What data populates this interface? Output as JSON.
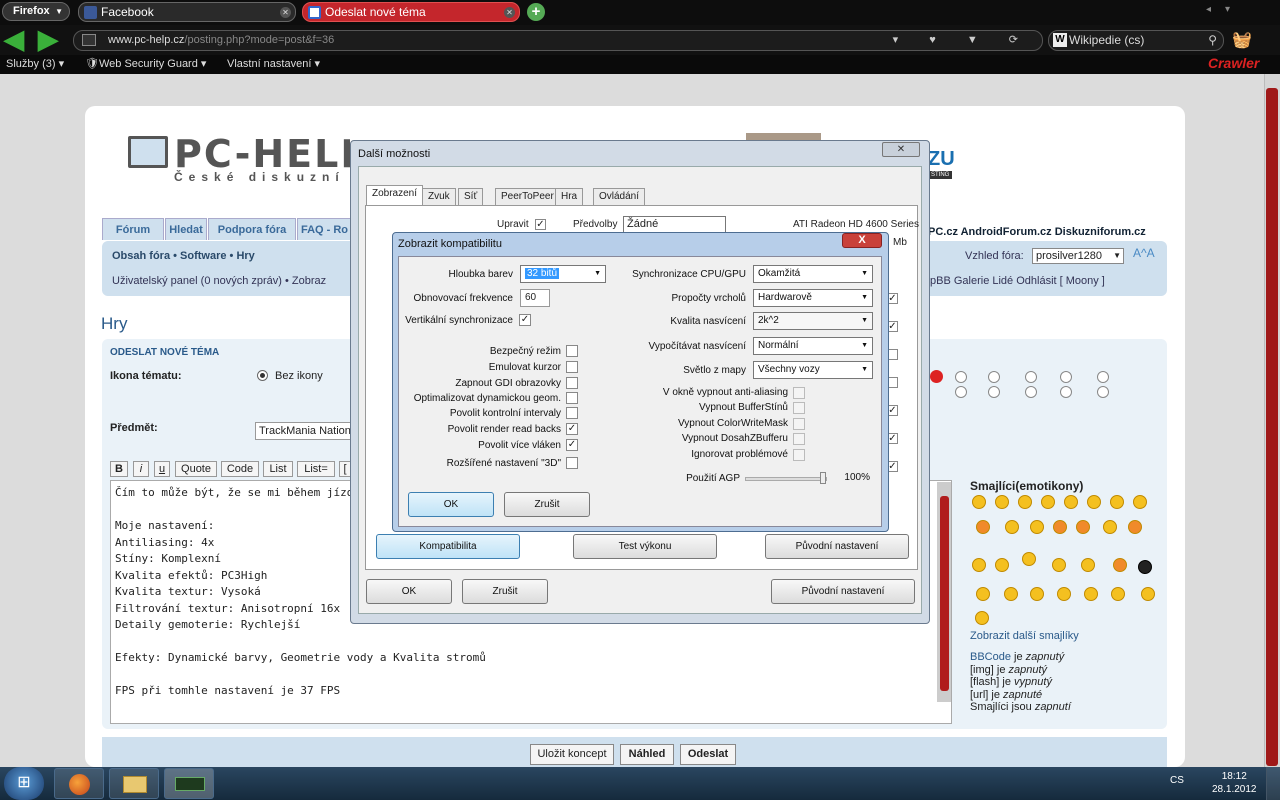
{
  "browser": {
    "menu_label": "Firefox",
    "tabs": [
      {
        "label": "Facebook",
        "color": "#3b5998"
      },
      {
        "label": "Odeslat nové téma",
        "color": "#c4262c"
      }
    ],
    "url_domain": "www.pc-help.cz",
    "url_path": "/posting.php?mode=post&f=36",
    "search_engine": "Wikipedie (cs)",
    "bookmarks": [
      "Služby (3) ▾",
      "Web Security Guard ▾",
      "Vlastní nastavení ▾"
    ],
    "toolbar_brand": "Crawler"
  },
  "site": {
    "logo_text": "PC-HELP",
    "logo_sub": "České diskuzní fórum",
    "logo_right": "ZU",
    "logo_host": "STING",
    "nav_tabs": [
      "Fórum",
      "Hledat",
      "Podpora fóra",
      "FAQ - Ro"
    ],
    "top_links": "PC.cz  AndroidForum.cz  Diskuzniforum.cz",
    "breadcrumb": "Obsah fóra • Software • Hry",
    "vzhled_label": "Vzhled fóra:",
    "vzhled_value": "prosilver1280",
    "user_panel": "Uživatelský panel (0 nových zpráv) • Zobraz",
    "right_links": "pBB  Galerie  Lidé  Odhlásit [ Moony ]",
    "page_heading": "Hry",
    "form_title": "ODESLAT NOVÉ TÉMA",
    "ikona_label": "Ikona tématu:",
    "bez_ikony": "Bez ikony",
    "predmet_label": "Předmět:",
    "subject_value": "TrackMania Nation",
    "toolbar_buttons": [
      "B",
      "i",
      "u",
      "Quote",
      "Code",
      "List",
      "List=",
      "["
    ],
    "editor_text": "Čím to může být, že se mi během jízdy  zobra\n\nMoje nastavení:\nAntiliasing: 4x\nStíny: Komplexní\nKvalita efektů: PC3High\nKvalita textur: Vysoká\nFiltrování textur: Anisotropní 16x\nDetaily gemoterie: Rychlejší\n\nEfekty: Dynamické barvy, Geometrie vody a Kvalita stromů\n\nFPS při tomhle nastavení je 37 FPS",
    "smajlici_title": "Smajlíci(emotikony)",
    "more_smileys": "Zobrazit další smajlíky",
    "bb_info": [
      {
        "name": "BBCode",
        "state": "zapnutý"
      },
      {
        "name": "[img]",
        "state": "zapnutý"
      },
      {
        "name": "[flash]",
        "state": "vypnutý"
      },
      {
        "name": "[url]",
        "state": "zapnuté"
      },
      {
        "name": "Smajlíci jsou",
        "state": "zapnutí"
      }
    ],
    "bb_je": "je",
    "submit_buttons": [
      "Uložit koncept",
      "Náhled",
      "Odeslat"
    ]
  },
  "outer_dialog": {
    "title": "Další možnosti",
    "tabs": [
      "Zobrazení",
      "Zvuk",
      "Síť",
      "PeerToPeer",
      "Hra",
      "Ovládání"
    ],
    "upravit": "Upravit",
    "predvolby": "Předvolby",
    "predvolby_value": "Žádné",
    "gpu": "ATI Radeon HD 4600 Series",
    "mem": "Mb",
    "buttons": [
      "Kompatibilita",
      "Test výkonu",
      "Původní nastavení"
    ],
    "bottom_buttons": [
      "OK",
      "Zrušit",
      "Původní nastavení"
    ]
  },
  "inner_dialog": {
    "title": "Zobrazit kompatibilitu",
    "close": "X",
    "left": {
      "hloubka_label": "Hloubka barev",
      "hloubka_value": "32 bitů",
      "obnov_label": "Obnovovací frekvence",
      "obnov_value": "60",
      "vsync_label": "Vertikální synchronizace",
      "checks": [
        {
          "label": "Bezpečný režim",
          "checked": false
        },
        {
          "label": "Emulovat kurzor",
          "checked": false
        },
        {
          "label": "Zapnout GDI obrazovky",
          "checked": false
        },
        {
          "label": "Optimalizovat dynamickou geom.",
          "checked": false
        },
        {
          "label": "Povolit kontrolní intervaly",
          "checked": false
        },
        {
          "label": "Povolit render read backs",
          "checked": true
        },
        {
          "label": "Povolit více vláken",
          "checked": true
        },
        {
          "label": "Rozšířené nastavení \"3D\"",
          "checked": false
        }
      ]
    },
    "right": {
      "selects": [
        {
          "label": "Synchronizace CPU/GPU",
          "value": "Okamžitá"
        },
        {
          "label": "Propočty vrcholů",
          "value": "Hardwarově"
        },
        {
          "label": "Kvalita nasvícení",
          "value": "2k^2"
        },
        {
          "label": "Vypočítávat nasvícení",
          "value": "Normální"
        },
        {
          "label": "Světlo z mapy",
          "value": "Všechny vozy"
        }
      ],
      "checks": [
        "V okně vypnout anti-aliasing",
        "Vypnout BufferStínů",
        "Vypnout ColorWriteMask",
        "Vypnout DosahZBufferu",
        "Ignorovat problémové"
      ],
      "agp_label": "Použití AGP",
      "agp_value": "100%",
      "agp_fraction": 1.0
    },
    "ok": "OK",
    "cancel": "Zrušit"
  },
  "taskbar": {
    "lang": "CS",
    "time": "18:12",
    "date": "28.1.2012"
  }
}
